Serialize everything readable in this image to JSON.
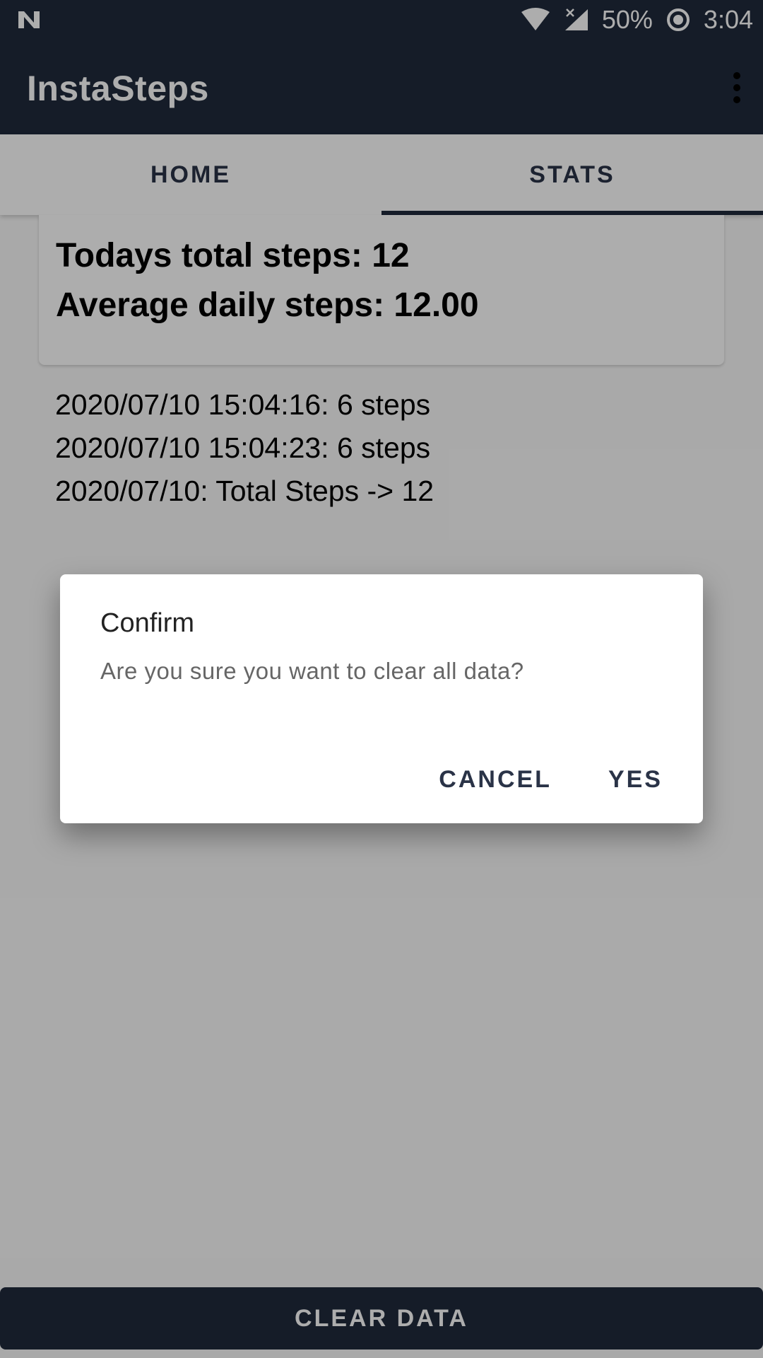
{
  "status_bar": {
    "notification_icon": "n-notification-icon",
    "wifi_icon": "wifi-icon",
    "signal_icon": "cell-signal-off-icon",
    "battery_percent": "50%",
    "battery_icon": "battery-ring-icon",
    "time": "3:04"
  },
  "app_bar": {
    "title": "InstaSteps",
    "overflow_icon": "more-vert-icon"
  },
  "tabs": [
    {
      "label": "HOME",
      "selected": false
    },
    {
      "label": "STATS",
      "selected": true
    }
  ],
  "stats": {
    "today_total": "Todays total steps: 12",
    "average_daily": "Average daily steps: 12.00"
  },
  "log": [
    "2020/07/10 15:04:16: 6 steps",
    "2020/07/10 15:04:23: 6 steps",
    "2020/07/10: Total Steps -> 12"
  ],
  "bottom_button": {
    "label": "CLEAR DATA"
  },
  "dialog": {
    "title": "Confirm",
    "message": "Are you sure you want to clear all data?",
    "cancel_label": "CANCEL",
    "yes_label": "YES"
  },
  "colors": {
    "primary": "#1f2a3c",
    "tab_text": "#2a3347",
    "scrim": "rgba(0,0,0,0.32)"
  }
}
